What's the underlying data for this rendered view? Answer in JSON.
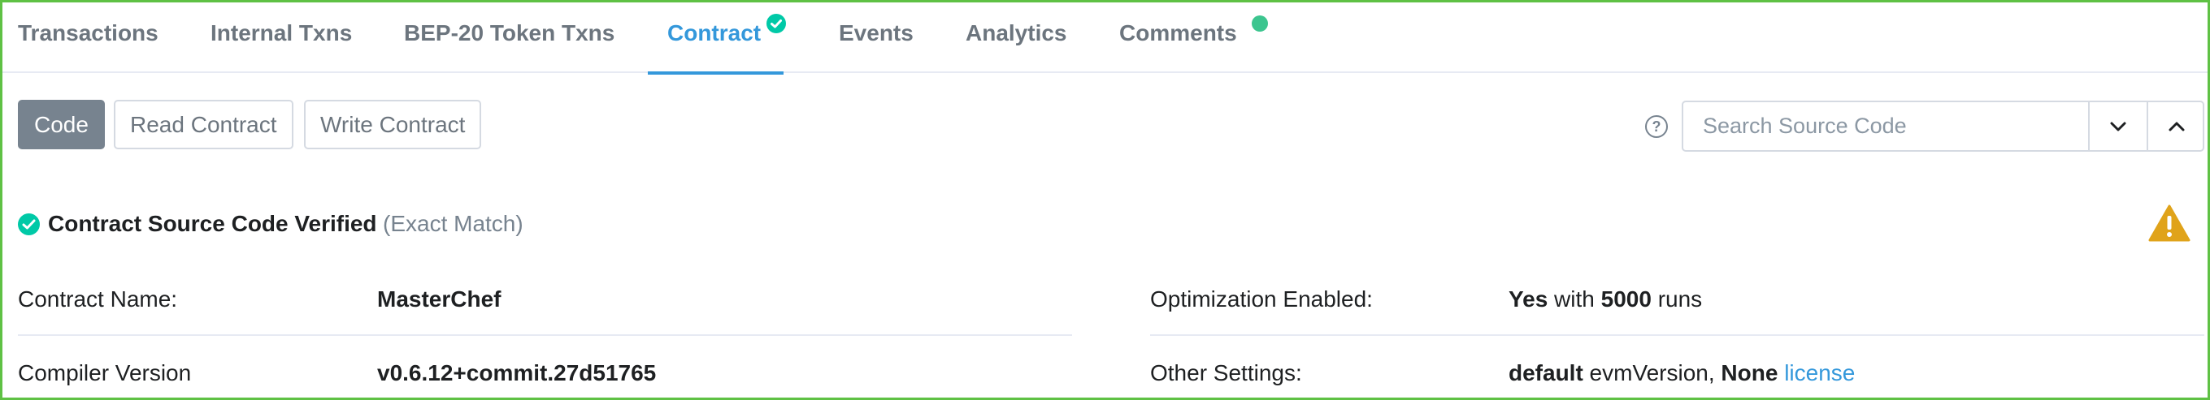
{
  "tabs": [
    {
      "label": "Transactions"
    },
    {
      "label": "Internal Txns"
    },
    {
      "label": "BEP-20 Token Txns"
    },
    {
      "label": "Contract",
      "active": true,
      "badge": "verified-check"
    },
    {
      "label": "Events"
    },
    {
      "label": "Analytics"
    },
    {
      "label": "Comments",
      "badge": "status-dot"
    }
  ],
  "buttons": {
    "code": "Code",
    "read_contract": "Read Contract",
    "write_contract": "Write Contract"
  },
  "help_icon": "?",
  "search": {
    "placeholder": "Search Source Code",
    "value": ""
  },
  "verified": {
    "title": "Contract Source Code Verified",
    "match": "(Exact Match)"
  },
  "info": {
    "contract_name_label": "Contract Name:",
    "contract_name_value": "MasterChef",
    "compiler_label": "Compiler Version",
    "compiler_value": "v0.6.12+commit.27d51765",
    "optimization_label": "Optimization Enabled:",
    "optimization_yes": "Yes",
    "optimization_with": " with ",
    "optimization_runs": "5000",
    "optimization_runs_suffix": " runs",
    "other_label": "Other Settings:",
    "other_default": "default",
    "other_evm": " evmVersion, ",
    "other_none": "None",
    "other_license": "license"
  },
  "colors": {
    "accent": "#3498db",
    "verified": "#00c9a7",
    "warning": "#e0a31a",
    "frame": "#5fc144"
  }
}
